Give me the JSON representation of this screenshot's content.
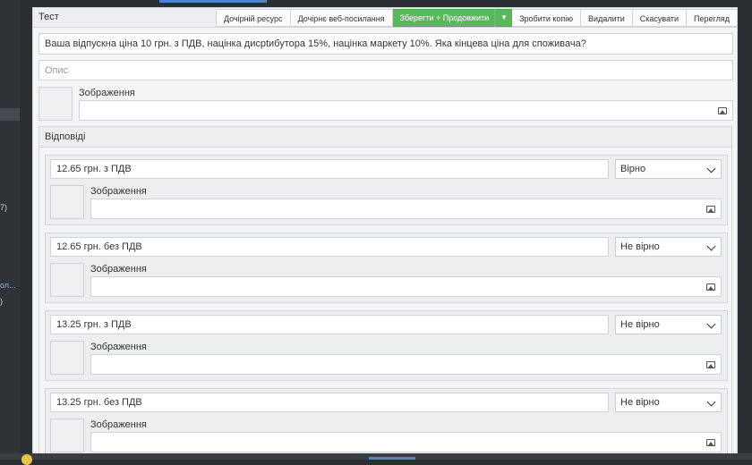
{
  "sidebar": {
    "items": [
      {
        "text": "7)"
      },
      {
        "text": "ол..."
      },
      {
        "text": ")"
      }
    ]
  },
  "panel": {
    "title": "Тест",
    "toolbar": {
      "child_resource": "Дочірній ресурс",
      "child_weblink": "Дочірнє веб-посилання",
      "save_continue": "Зберегти + Продовжити",
      "duplicate": "Зробити копію",
      "delete": "Видалити",
      "cancel": "Скасувати",
      "view": "Перегляд"
    },
    "question": "Ваша відпускна ціна 10 грн. з ПДВ, націнка дисрtибутора 15%, націнка маркету 10%. Яка кінцева ціна для споживача?",
    "description_placeholder": "Опис",
    "image_label": "Зображення"
  },
  "answers": {
    "title": "Відповіді",
    "items": [
      {
        "text": "12.65 грн. з ПДВ",
        "status": "Вірно",
        "image_label": "Зображення"
      },
      {
        "text": "12.65 грн. без ПДВ",
        "status": "Не вірно",
        "image_label": "Зображення"
      },
      {
        "text": "13.25 грн. з ПДВ",
        "status": "Не вірно",
        "image_label": "Зображення"
      },
      {
        "text": "13.25 грн. без ПДВ",
        "status": "Не вірно",
        "image_label": "Зображення"
      }
    ]
  },
  "colors": {
    "save_button": "#5cb85c",
    "panel_bg": "#f4f5f6",
    "outer_bg": "#2b2e33"
  }
}
